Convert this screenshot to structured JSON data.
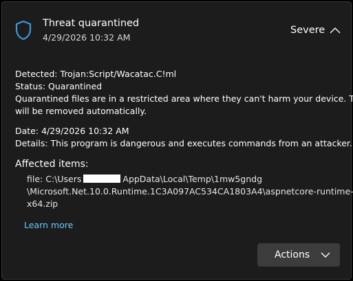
{
  "notification": {
    "title": "Threat quarantined",
    "timestamp": "4/29/2026 10:32 AM",
    "severity": "Severe"
  },
  "details": {
    "detected_label": "Detected:",
    "detected_value": "Trojan:Script/Wacatac.C!ml",
    "status_label": "Status:",
    "status_value": "Quarantined",
    "status_description_line1": "Quarantined files are in a restricted area where they can't harm your device. They",
    "status_description_line2": "will be removed automatically.",
    "date_label": "Date:",
    "date_value": "4/29/2026 10:32 AM",
    "details_label": "Details:",
    "details_value": "This program is dangerous and executes commands from an attacker."
  },
  "affected": {
    "heading": "Affected items:",
    "path_prefix": "file: C:\\Users",
    "path_line1_rest": "AppData\\Local\\Temp\\1mw5gndg",
    "path_line2": "\\Microsoft.Net.10.0.Runtime.1C3A097AC534CA1803A4\\aspnetcore-runtime-",
    "path_line3": "x64.zip"
  },
  "learn_more": "Learn more",
  "actions_label": "Actions",
  "icons": {
    "shield": "shield-icon",
    "collapse": "chevron-up-icon",
    "dropdown": "chevron-down-icon"
  },
  "colors": {
    "background": "#1c1c1c",
    "accent_icon": "#3a9bdc",
    "link": "#6ccaff",
    "button": "#3c3c3c"
  }
}
